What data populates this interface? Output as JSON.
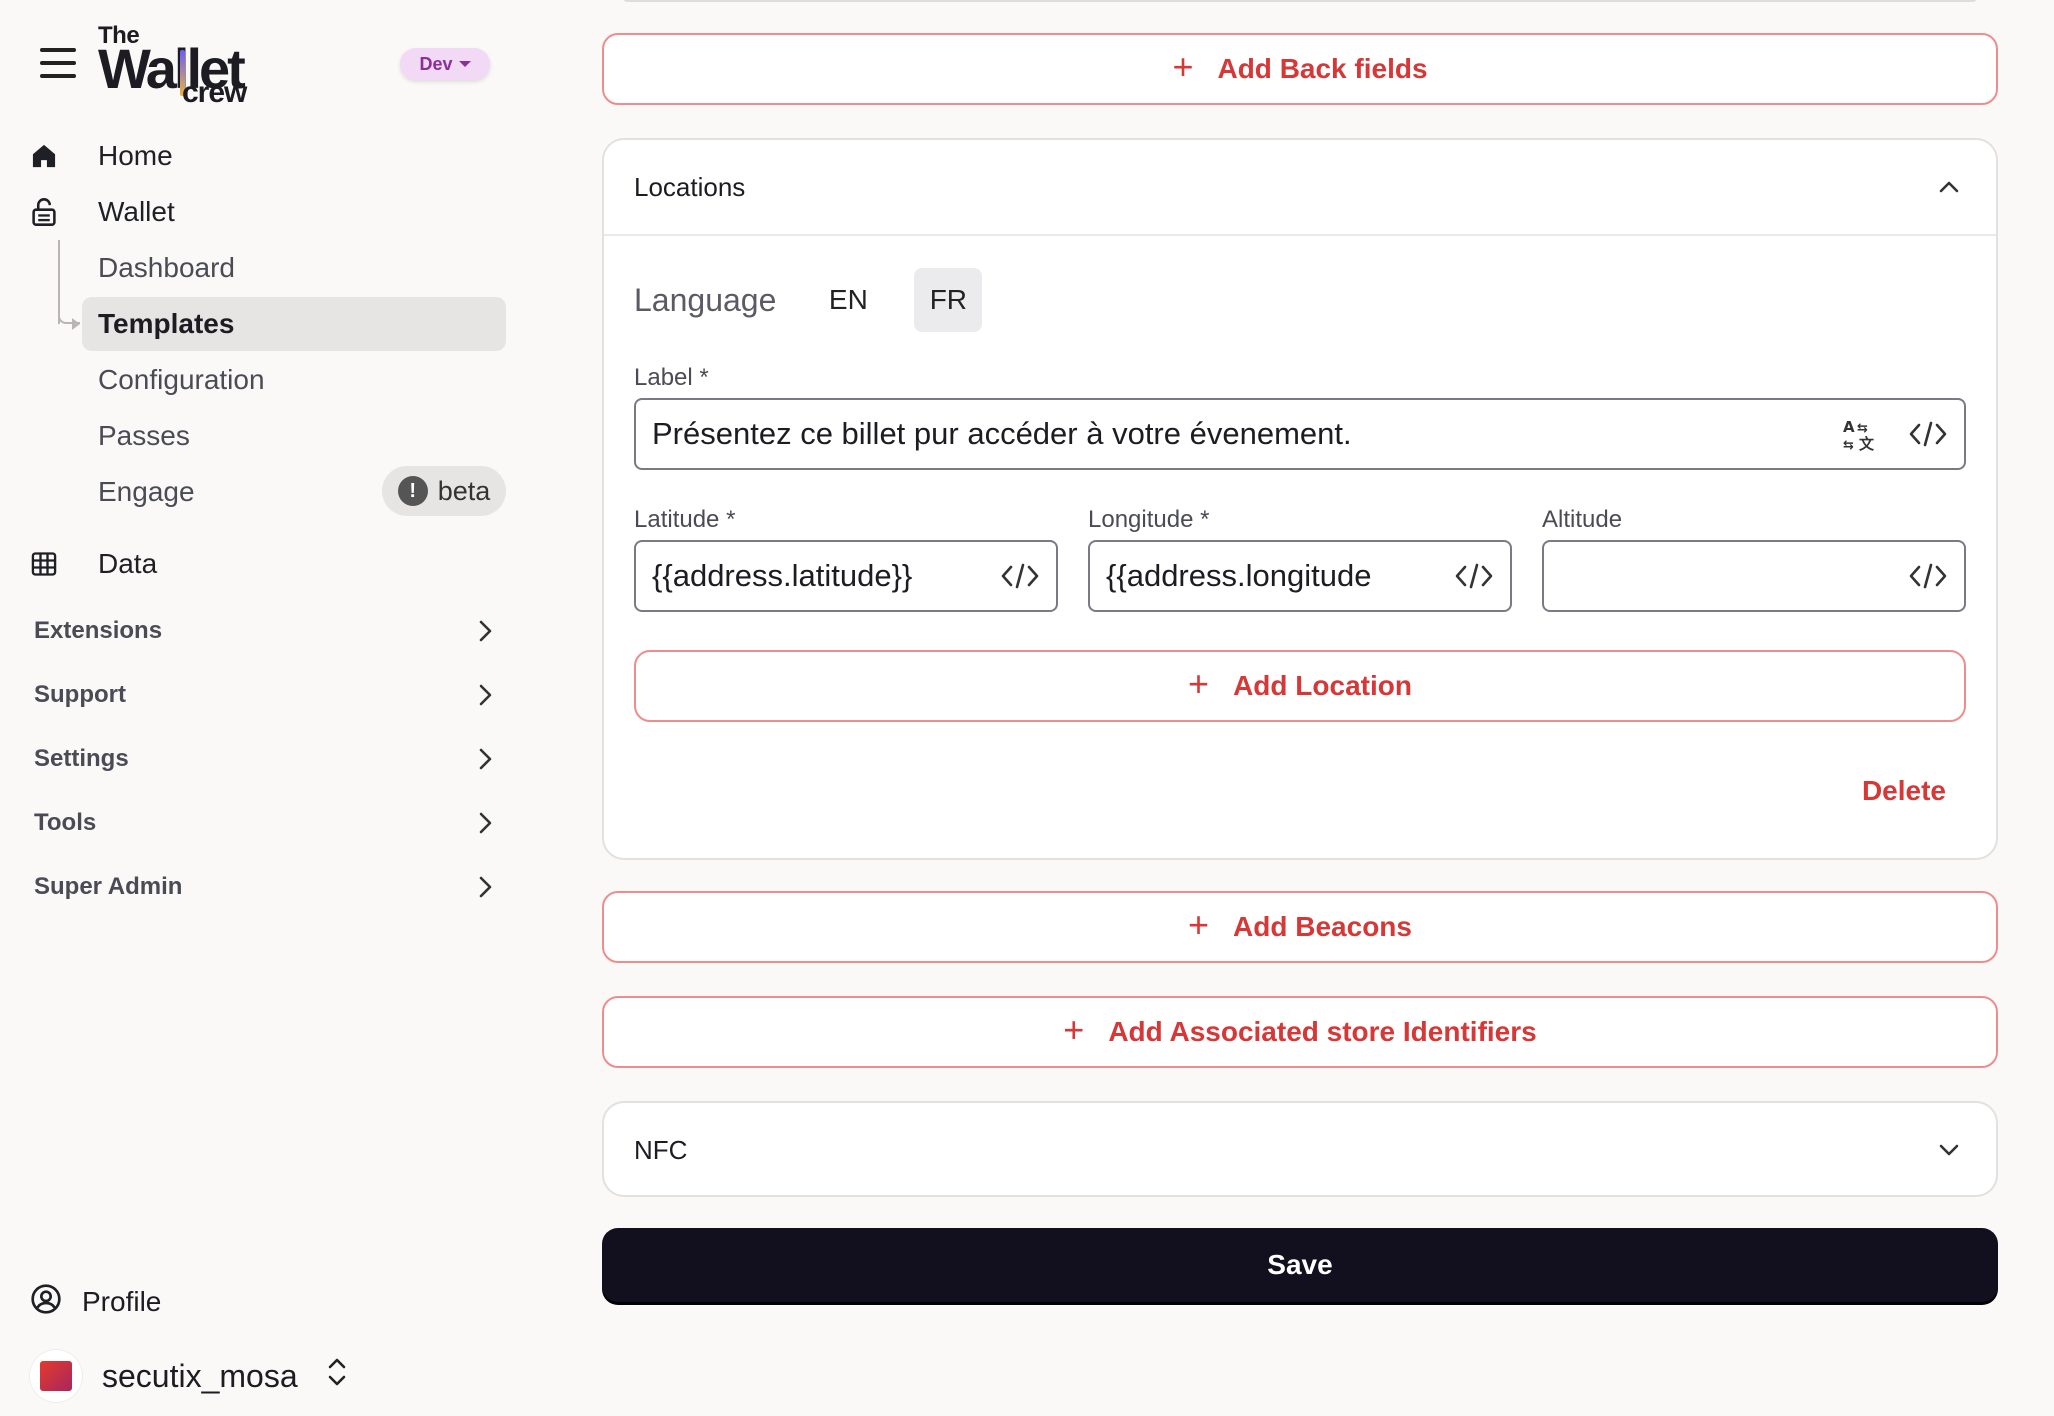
{
  "sidebar": {
    "env_badge": "Dev",
    "logo": {
      "line1": "The",
      "line2": "Wallet",
      "line3": "crew"
    },
    "nav": {
      "home": "Home",
      "wallet": "Wallet",
      "dashboard": "Dashboard",
      "templates": "Templates",
      "configuration": "Configuration",
      "passes": "Passes",
      "engage": "Engage",
      "beta": "beta",
      "data": "Data"
    },
    "groups": {
      "extensions": "Extensions",
      "support": "Support",
      "settings": "Settings",
      "tools": "Tools",
      "super_admin": "Super Admin"
    },
    "profile": "Profile",
    "account": "secutix_mosa"
  },
  "main": {
    "add_back_fields": "Add Back fields",
    "locations": {
      "title": "Locations",
      "language_label": "Language",
      "languages": [
        "EN",
        "FR"
      ],
      "active_language": "FR",
      "label_field": {
        "label": "Label *",
        "value": "Présentez ce billet pur accéder à votre évenement."
      },
      "latitude": {
        "label": "Latitude *",
        "value": "{{address.latitude}}"
      },
      "longitude": {
        "label": "Longitude *",
        "value": "{{address.longitude"
      },
      "altitude": {
        "label": "Altitude",
        "value": ""
      },
      "add_location": "Add Location",
      "delete": "Delete"
    },
    "add_beacons": "Add Beacons",
    "add_store_ids": "Add Associated store Identifiers",
    "nfc": {
      "title": "NFC"
    },
    "save": "Save"
  },
  "colors": {
    "accent_red": "#d63838",
    "save_bg": "#12101f",
    "env_badge_bg": "#f2d9f5"
  }
}
